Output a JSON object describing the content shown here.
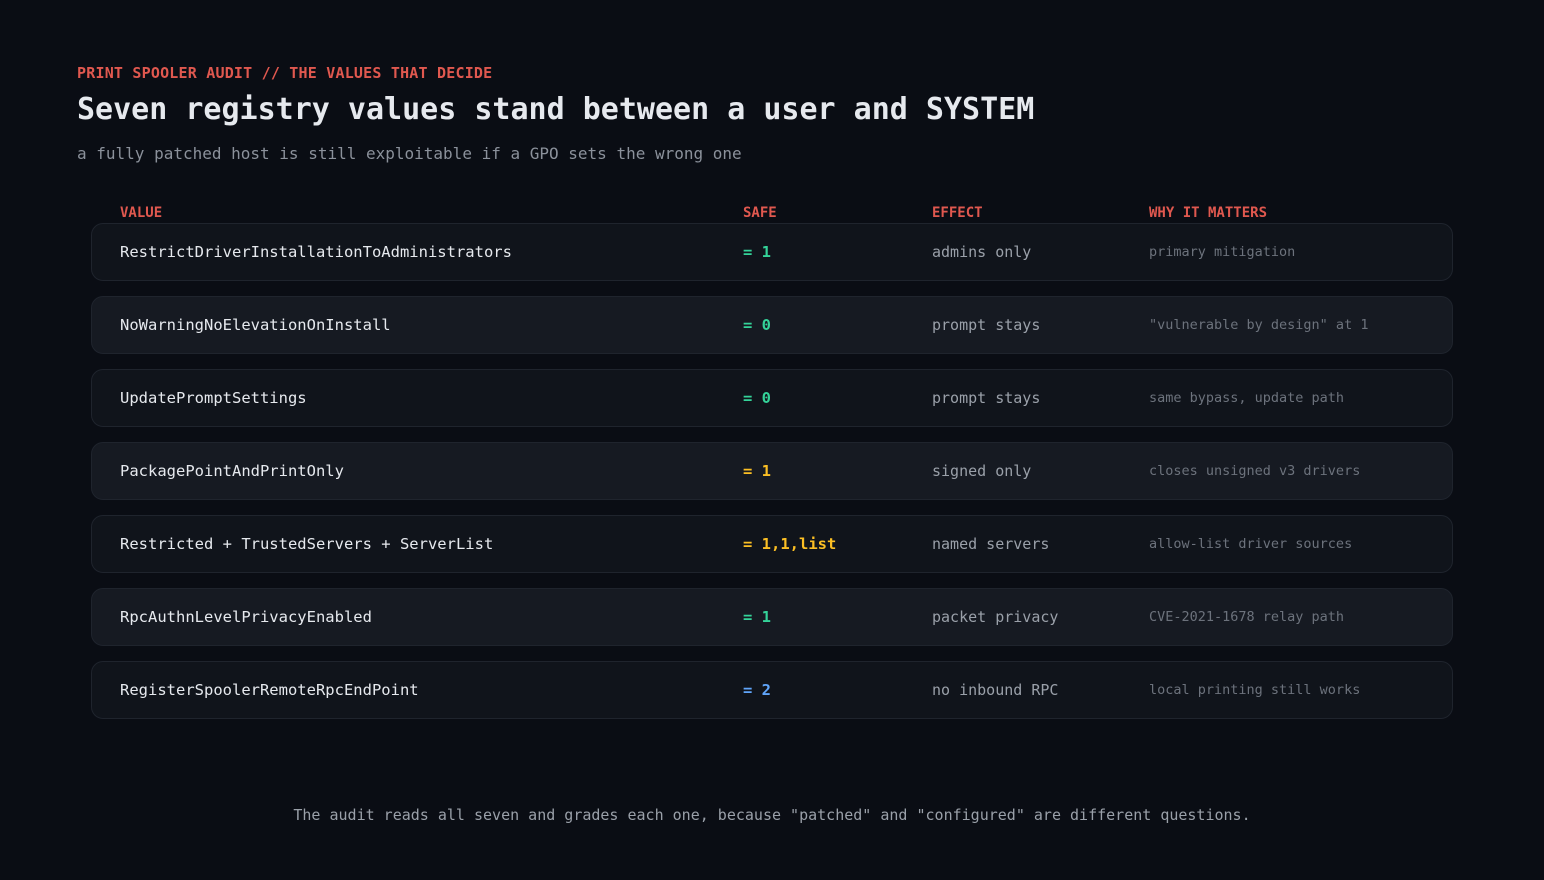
{
  "eyebrow": "PRINT SPOOLER AUDIT // THE VALUES THAT DECIDE",
  "title": "Seven registry values stand between a user and SYSTEM",
  "subtitle": "a fully patched host is still exploitable if a GPO sets the wrong one",
  "columns": {
    "value": "VALUE",
    "safe": "SAFE",
    "effect": "EFFECT",
    "why": "WHY IT MATTERS"
  },
  "colors": {
    "accent": "#e0584f",
    "safe_green": "#34d399",
    "safe_amber": "#fbbf24",
    "safe_blue": "#60a5fa"
  },
  "rows": [
    {
      "name": "RestrictDriverInstallationToAdministrators",
      "safe": "= 1",
      "effect": "admins only",
      "why": "primary mitigation",
      "safe_color": "#34d399"
    },
    {
      "name": "NoWarningNoElevationOnInstall",
      "safe": "= 0",
      "effect": "prompt stays",
      "why": "\"vulnerable by design\" at 1",
      "safe_color": "#34d399"
    },
    {
      "name": "UpdatePromptSettings",
      "safe": "= 0",
      "effect": "prompt stays",
      "why": "same bypass, update path",
      "safe_color": "#34d399"
    },
    {
      "name": "PackagePointAndPrintOnly",
      "safe": "= 1",
      "effect": "signed only",
      "why": "closes unsigned v3 drivers",
      "safe_color": "#fbbf24"
    },
    {
      "name": "Restricted + TrustedServers + ServerList",
      "safe": "= 1,1,list",
      "effect": "named servers",
      "why": "allow-list driver sources",
      "safe_color": "#fbbf24"
    },
    {
      "name": "RpcAuthnLevelPrivacyEnabled",
      "safe": "= 1",
      "effect": "packet privacy",
      "why": "CVE-2021-1678 relay path",
      "safe_color": "#34d399"
    },
    {
      "name": "RegisterSpoolerRemoteRpcEndPoint",
      "safe": "= 2",
      "effect": "no inbound RPC",
      "why": "local printing still works",
      "safe_color": "#60a5fa"
    }
  ],
  "footer": "The audit reads all seven and grades each one, because \"patched\" and \"configured\" are different questions."
}
